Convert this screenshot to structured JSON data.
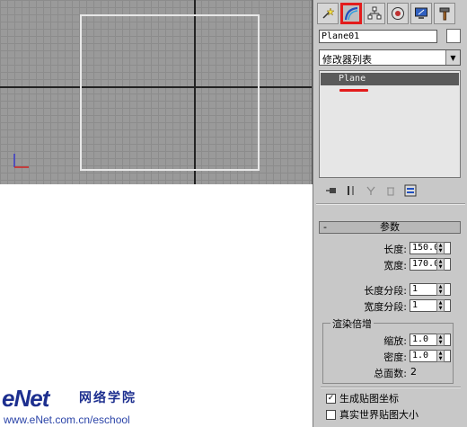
{
  "command_panel": {
    "tabs": [
      {
        "name": "create-tab",
        "icon": "create-star-icon"
      },
      {
        "name": "modify-tab",
        "icon": "modify-arc-icon",
        "active": true
      },
      {
        "name": "hierarchy-tab",
        "icon": "hierarchy-icon"
      },
      {
        "name": "motion-tab",
        "icon": "motion-icon"
      },
      {
        "name": "display-tab",
        "icon": "display-monitor-icon"
      },
      {
        "name": "utilities-tab",
        "icon": "utilities-hammer-icon"
      }
    ],
    "object_name": "Plane01",
    "modifier_list_label": "修改器列表",
    "stack_item": "Plane",
    "highlight_color": "#e31c1c"
  },
  "parameters": {
    "rollout_minus": "-",
    "rollout_title": "参数",
    "length_label": "长度:",
    "length_value": "150.0",
    "width_label": "宽度:",
    "width_value": "170.0",
    "length_segs_label": "长度分段:",
    "length_segs_value": "1",
    "width_segs_label": "宽度分段:",
    "width_segs_value": "1",
    "render_group_title": "渲染倍增",
    "scale_label": "缩放:",
    "scale_value": "1.0",
    "density_label": "密度:",
    "density_value": "1.0",
    "total_faces_label": "总面数:",
    "total_faces_value": "2",
    "gen_mapping_label": "生成贴图坐标",
    "gen_mapping_checked": true,
    "real_world_label": "真实世界贴图大小",
    "real_world_checked": false
  },
  "watermark": {
    "logo": "eNet",
    "cn_name": "网络学院",
    "url": "www.eNet.com.cn/eschool"
  }
}
